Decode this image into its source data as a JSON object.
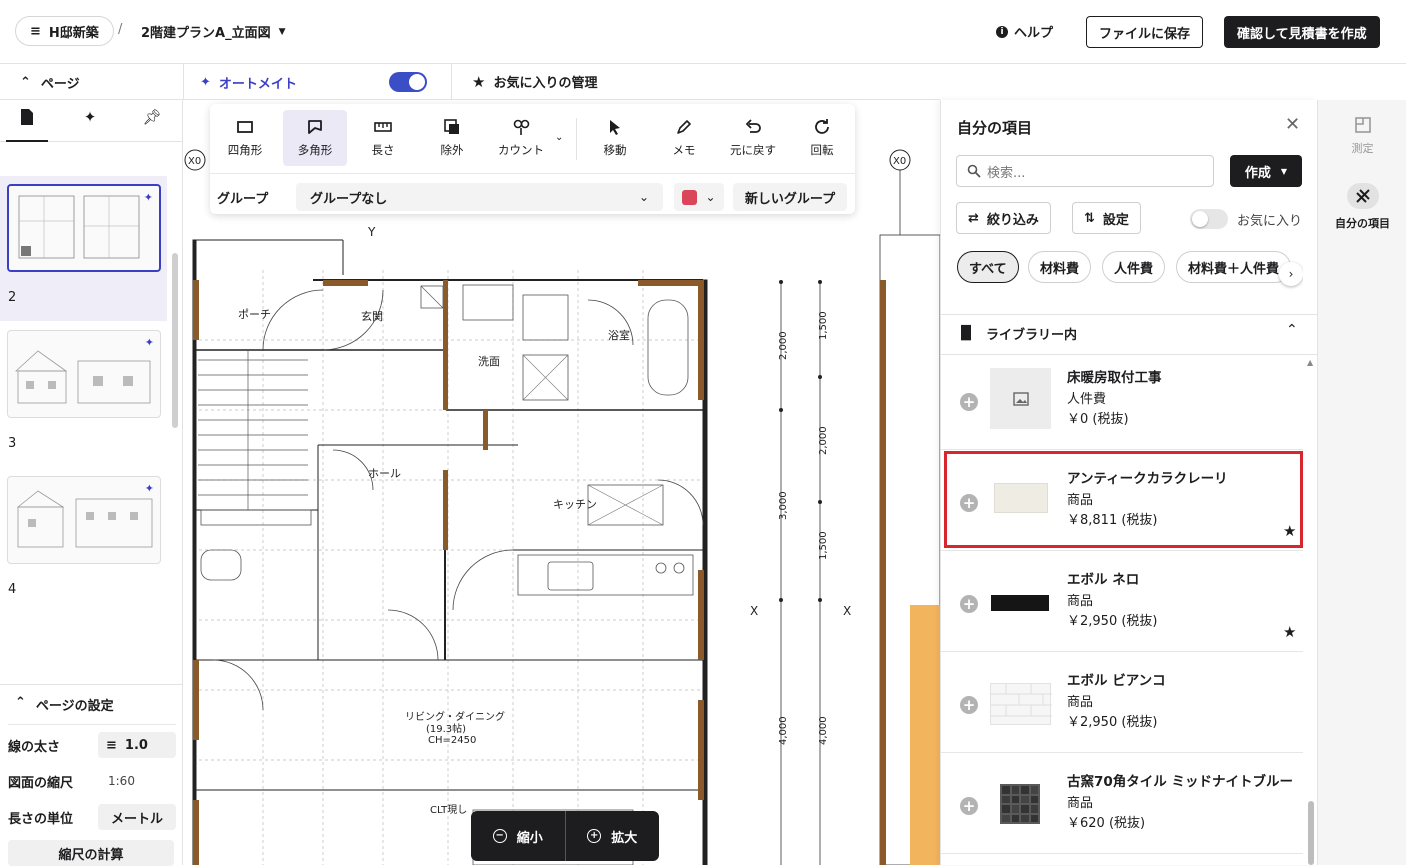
{
  "header": {
    "project_name": "H邸新築",
    "separator": "/",
    "document_name": "2階建プランA_立面図",
    "help_label": "ヘルプ",
    "save_label": "ファイルに保存",
    "estimate_label": "確認して見積書を作成"
  },
  "subbar": {
    "pages_label": "ページ",
    "automate_label": "オートメイト",
    "automate_enabled": true,
    "favorites_label": "お気に入りの管理"
  },
  "sidebar": {
    "pages": [
      {
        "number": "2",
        "selected": true
      },
      {
        "number": "3",
        "selected": false
      },
      {
        "number": "4",
        "selected": false
      }
    ],
    "settings": {
      "title": "ページの設定",
      "line_width_label": "線の太さ",
      "line_width_value": "1.0",
      "scale_label": "図面の縮尺",
      "scale_value": "1:60",
      "length_unit_label": "長さの単位",
      "length_unit_value": "メートル",
      "calc_scale_label": "縮尺の計算"
    }
  },
  "toolbar": {
    "tools": [
      {
        "label": "四角形",
        "icon": "rectangle-icon",
        "active": false
      },
      {
        "label": "多角形",
        "icon": "polygon-icon",
        "active": true
      },
      {
        "label": "長さ",
        "icon": "ruler-icon",
        "active": false
      },
      {
        "label": "除外",
        "icon": "exclude-icon",
        "active": false
      },
      {
        "label": "カウント",
        "icon": "count-icon",
        "active": false
      },
      {
        "label": "移動",
        "icon": "cursor-icon",
        "active": false
      },
      {
        "label": "メモ",
        "icon": "pen-icon",
        "active": false
      },
      {
        "label": "元に戻す",
        "icon": "undo-icon",
        "active": false
      },
      {
        "label": "回転",
        "icon": "rotate-icon",
        "active": false
      }
    ],
    "group_label": "グループ",
    "group_value": "グループなし",
    "group_color": "#d9465a",
    "new_group_label": "新しいグループ"
  },
  "floorplan": {
    "rooms": [
      "ポーチ",
      "玄関",
      "洗面",
      "浴室",
      "ホール",
      "キッチン",
      "リビング・ダイニング",
      "(19.3帖)",
      "CH=2450",
      "CLT現し"
    ],
    "dimensions": [
      "2,000",
      "1,500",
      "2,000",
      "3,000",
      "1,500",
      "4,000",
      "4,000"
    ],
    "markers": [
      "X0",
      "X0",
      "Y",
      "X",
      "X"
    ]
  },
  "zoom": {
    "zoom_out_label": "縮小",
    "zoom_in_label": "拡大"
  },
  "panel": {
    "title": "自分の項目",
    "search_placeholder": "検索...",
    "create_label": "作成",
    "filter_label": "絞り込み",
    "settings_label": "設定",
    "favorites_toggle_label": "お気に入り",
    "chips": [
      "すべて",
      "材料費",
      "人件費",
      "材料費＋人件費"
    ],
    "library_label": "ライブラリー内",
    "items": [
      {
        "name": "床暖房取付工事",
        "type": "人件費",
        "price": "￥0 (税抜)",
        "favorite": false,
        "highlighted": false
      },
      {
        "name": "アンティークカラクレーリ",
        "type": "商品",
        "price": "￥8,811 (税抜)",
        "favorite": true,
        "highlighted": true
      },
      {
        "name": "エボル ネロ",
        "type": "商品",
        "price": "￥2,950 (税抜)",
        "favorite": true,
        "highlighted": false
      },
      {
        "name": "エボル ビアンコ",
        "type": "商品",
        "price": "￥2,950 (税抜)",
        "favorite": false,
        "highlighted": false
      },
      {
        "name": "古窯70角タイル ミッドナイトブルー",
        "type": "商品",
        "price": "￥620 (税抜)",
        "favorite": false,
        "highlighted": false
      }
    ],
    "highlight_color": "#d7262e"
  },
  "rail": {
    "measure_label": "測定",
    "my_items_label": "自分の項目"
  }
}
